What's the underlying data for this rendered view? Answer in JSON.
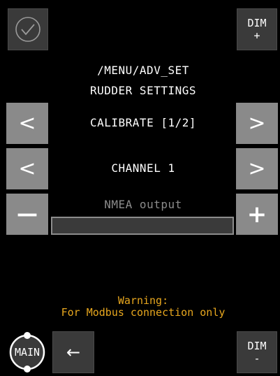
{
  "header": {
    "path": "/MENU/ADV_SET",
    "title": "RUDDER SETTINGS"
  },
  "controls": {
    "confirm_icon": "check-circle-icon",
    "dim_plus": {
      "line1": "DIM",
      "line2": "+"
    },
    "dim_minus": {
      "line1": "DIM",
      "line2": "-"
    },
    "main_label": "MAIN",
    "back_glyph": "←"
  },
  "rows": {
    "calibrate": {
      "prev": "<",
      "label": "CALIBRATE [1/2]",
      "next": ">"
    },
    "channel": {
      "prev": "<",
      "label": "CHANNEL 1",
      "next": ">"
    },
    "nmea": {
      "minus": "—",
      "label": "NMEA output",
      "plus": "+",
      "level": 0
    }
  },
  "warning": {
    "line1": "Warning:",
    "line2": "For Modbus connection only"
  },
  "colors": {
    "background": "#000000",
    "button_grey": "#8a8a8a",
    "button_dark": "#3a3a3a",
    "warning": "#e8a71e",
    "disabled_text": "#8c8c8c"
  }
}
